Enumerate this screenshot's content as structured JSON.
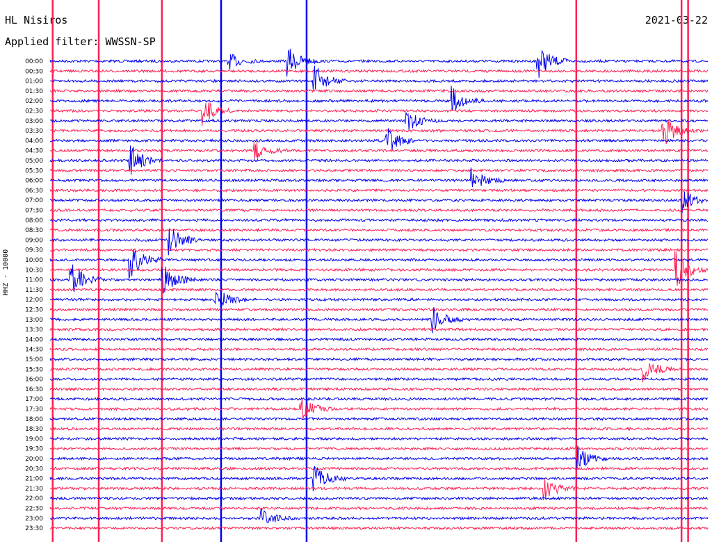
{
  "header": {
    "station": "HL Nisiros",
    "date": "2021-03-22",
    "filter": "Applied filter: WWSSN-SP",
    "channel": "HHZ - 10000"
  },
  "colors": {
    "trace_a": "#0000ee",
    "trace_b": "#ff1f52"
  },
  "chart_data": {
    "type": "line",
    "title": "HL Nisiros",
    "xlabel": "",
    "ylabel": "HHZ - 10000",
    "row_labels": [
      "00:00",
      "00:30",
      "01:00",
      "01:30",
      "02:00",
      "02:30",
      "03:00",
      "03:30",
      "04:00",
      "04:30",
      "05:00",
      "05:30",
      "06:00",
      "06:30",
      "07:00",
      "07:30",
      "08:00",
      "08:30",
      "09:00",
      "09:30",
      "10:00",
      "10:30",
      "11:00",
      "11:30",
      "12:00",
      "12:30",
      "13:00",
      "13:30",
      "14:00",
      "14:30",
      "15:00",
      "15:30",
      "16:00",
      "16:30",
      "17:00",
      "17:30",
      "18:00",
      "18:30",
      "19:00",
      "19:30",
      "20:00",
      "20:30",
      "21:00",
      "21:30",
      "22:00",
      "22:30",
      "23:00",
      "23:30"
    ],
    "row_colors": [
      "a",
      "b",
      "a",
      "b",
      "a",
      "b",
      "a",
      "b",
      "a",
      "b",
      "a",
      "b",
      "a",
      "b",
      "a",
      "b",
      "a",
      "b",
      "a",
      "b",
      "a",
      "b",
      "a",
      "b",
      "a",
      "b",
      "a",
      "b",
      "a",
      "b",
      "a",
      "b",
      "a",
      "b",
      "a",
      "b",
      "a",
      "b",
      "a",
      "b",
      "a",
      "b",
      "a",
      "b",
      "a",
      "b",
      "a",
      "b"
    ],
    "events": [
      {
        "row": 0,
        "t": 0.27,
        "amp": 1.0
      },
      {
        "row": 0,
        "t": 0.36,
        "amp": 1.8
      },
      {
        "row": 0,
        "t": 0.74,
        "amp": 2.2
      },
      {
        "row": 2,
        "t": 0.4,
        "amp": 2.0
      },
      {
        "row": 4,
        "t": 0.61,
        "amp": 1.6
      },
      {
        "row": 5,
        "t": 0.23,
        "amp": 1.8
      },
      {
        "row": 6,
        "t": 0.54,
        "amp": 1.5
      },
      {
        "row": 7,
        "t": 0.93,
        "amp": 2.0
      },
      {
        "row": 8,
        "t": 0.51,
        "amp": 1.8
      },
      {
        "row": 9,
        "t": 0.31,
        "amp": 1.2
      },
      {
        "row": 10,
        "t": 0.12,
        "amp": 2.0
      },
      {
        "row": 12,
        "t": 0.64,
        "amp": 1.4
      },
      {
        "row": 14,
        "t": 0.96,
        "amp": 1.4
      },
      {
        "row": 18,
        "t": 0.18,
        "amp": 1.8
      },
      {
        "row": 20,
        "t": 0.12,
        "amp": 2.4
      },
      {
        "row": 21,
        "t": 0.95,
        "amp": 2.4
      },
      {
        "row": 22,
        "t": 0.03,
        "amp": 2.2
      },
      {
        "row": 22,
        "t": 0.17,
        "amp": 2.0
      },
      {
        "row": 24,
        "t": 0.25,
        "amp": 1.6
      },
      {
        "row": 26,
        "t": 0.58,
        "amp": 1.6
      },
      {
        "row": 31,
        "t": 0.9,
        "amp": 1.6
      },
      {
        "row": 35,
        "t": 0.38,
        "amp": 1.6
      },
      {
        "row": 40,
        "t": 0.8,
        "amp": 1.5
      },
      {
        "row": 42,
        "t": 0.4,
        "amp": 1.8
      },
      {
        "row": 43,
        "t": 0.75,
        "amp": 1.4
      },
      {
        "row": 46,
        "t": 0.32,
        "amp": 1.2
      }
    ],
    "spikes": [
      {
        "t": 0.004,
        "color": "b"
      },
      {
        "t": 0.074,
        "color": "b"
      },
      {
        "t": 0.17,
        "color": "b"
      },
      {
        "t": 0.26,
        "color": "a"
      },
      {
        "t": 0.39,
        "color": "a"
      },
      {
        "t": 0.8,
        "color": "b"
      },
      {
        "t": 0.96,
        "color": "b"
      },
      {
        "t": 0.97,
        "color": "b"
      }
    ]
  }
}
